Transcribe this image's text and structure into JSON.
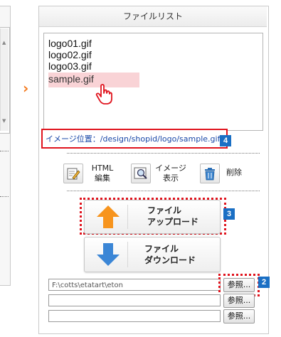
{
  "panel": {
    "title": "ファイルリスト"
  },
  "file_list": {
    "items": [
      "logo01.gif",
      "logo02.gif",
      "logo03.gif",
      "sample.gif"
    ],
    "selected": "sample.gif"
  },
  "image_path": "イメージ位置：/design/shopid/logo/sample.gif",
  "toolbar": {
    "html_edit": [
      "HTML",
      "編集"
    ],
    "image_view": [
      "イメージ",
      "表示"
    ],
    "delete": "削除"
  },
  "upload_button": [
    "ファイル",
    "アップロード"
  ],
  "download_button": [
    "ファイル",
    "ダウンロード"
  ],
  "upload_fields": [
    {
      "value": "F:\\cotts\\etatart\\eton"
    },
    {
      "value": ""
    },
    {
      "value": ""
    }
  ],
  "browse_label": "参照...",
  "badges": {
    "path": "4",
    "upload": "3",
    "browse": "2"
  },
  "colors": {
    "accent_red": "#e0141e",
    "badge_blue": "#1a6fc4",
    "arrow_orange": "#f7941d",
    "arrow_blue": "#3b86d6",
    "selected_bg": "#f9d3d6"
  }
}
